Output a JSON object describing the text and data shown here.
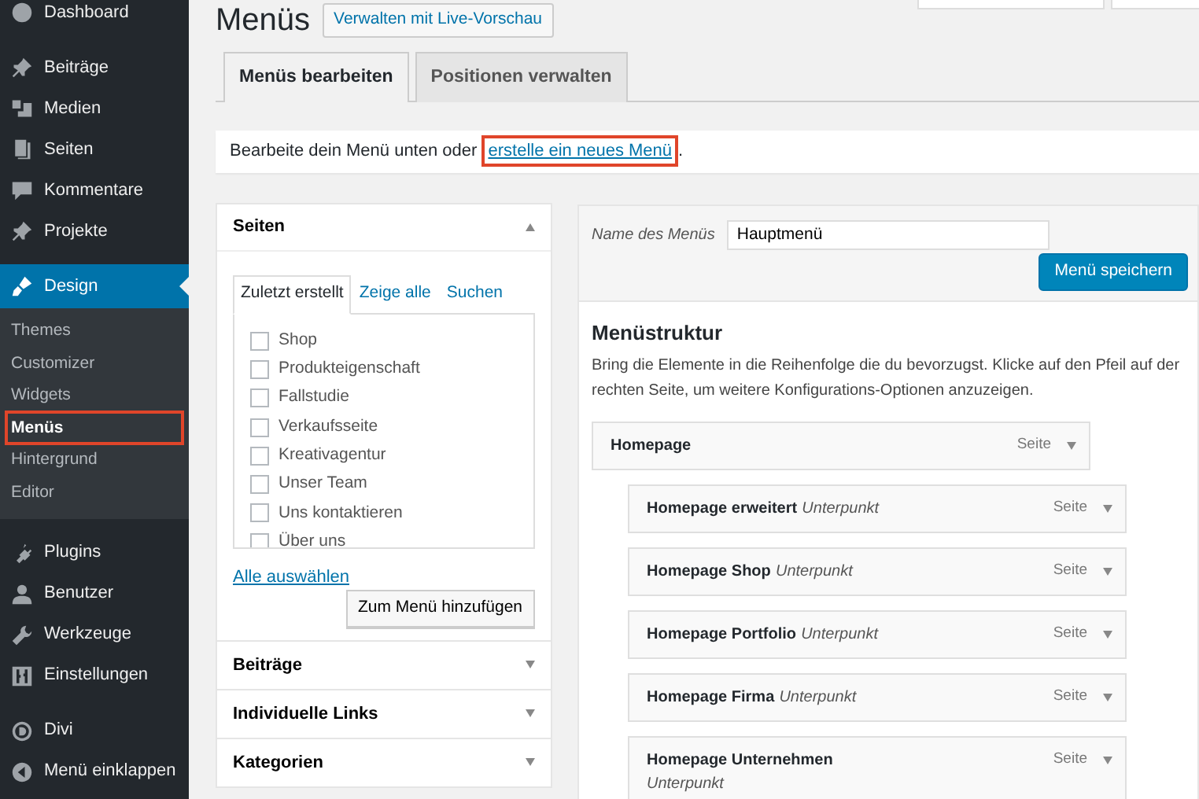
{
  "sidebar": {
    "items": [
      {
        "label": "Dashboard",
        "selected": false
      },
      {
        "label": "Beiträge",
        "selected": false
      },
      {
        "label": "Medien",
        "selected": false
      },
      {
        "label": "Seiten",
        "selected": false
      },
      {
        "label": "Kommentare",
        "selected": false
      },
      {
        "label": "Projekte",
        "selected": false
      },
      {
        "label": "Design",
        "selected": true,
        "children": [
          {
            "label": "Themes",
            "selected": false,
            "highlighted": false
          },
          {
            "label": "Customizer",
            "selected": false,
            "highlighted": false
          },
          {
            "label": "Widgets",
            "selected": false,
            "highlighted": false
          },
          {
            "label": "Menüs",
            "selected": true,
            "highlighted": true
          },
          {
            "label": "Hintergrund",
            "selected": false,
            "highlighted": false
          },
          {
            "label": "Editor",
            "selected": false,
            "highlighted": false
          }
        ]
      },
      {
        "label": "Plugins",
        "selected": false
      },
      {
        "label": "Benutzer",
        "selected": false
      },
      {
        "label": "Werkzeuge",
        "selected": false
      },
      {
        "label": "Einstellungen",
        "selected": false
      },
      {
        "label": "Divi",
        "selected": false
      },
      {
        "label": "Menü einklappen",
        "selected": false
      }
    ]
  },
  "page": {
    "title": "Menüs",
    "live_preview_button": "Verwalten mit Live-Vorschau"
  },
  "tabs": [
    {
      "label": "Menüs bearbeiten",
      "selected": true
    },
    {
      "label": "Positionen verwalten",
      "selected": false
    }
  ],
  "notice": {
    "text": "Bearbeite dein Menü unten oder",
    "link": "erstelle ein neues Menü",
    "link_highlighted": true,
    "end": "."
  },
  "panels": [
    {
      "title": "Seiten",
      "expanded": true,
      "tabs": [
        {
          "label": "Zuletzt erstellt",
          "selected": true
        },
        {
          "label": "Zeige alle",
          "selected": false
        },
        {
          "label": "Suchen",
          "selected": false
        }
      ],
      "items": [
        {
          "label": "Shop",
          "checked": false
        },
        {
          "label": "Produkteigenschaft",
          "checked": false
        },
        {
          "label": "Fallstudie",
          "checked": false
        },
        {
          "label": "Verkaufsseite",
          "checked": false
        },
        {
          "label": "Kreativagentur",
          "checked": false
        },
        {
          "label": "Unser Team",
          "checked": false
        },
        {
          "label": "Uns kontaktieren",
          "checked": false
        },
        {
          "label": "Über uns",
          "checked": false
        }
      ],
      "select_all": "Alle auswählen",
      "add_button": "Zum Menü hinzufügen"
    },
    {
      "title": "Beiträge",
      "expanded": false
    },
    {
      "title": "Individuelle Links",
      "expanded": false
    },
    {
      "title": "Kategorien",
      "expanded": false
    }
  ],
  "menu_editor": {
    "name_label": "Name des Menüs",
    "name_value": "Hauptmenü",
    "save_button": "Menü speichern",
    "heading": "Menüstruktur",
    "description": "Bring die Elemente in die Reihenfolge die du bevorzugst. Klicke auf den Pfeil auf der rechten Seite, um weitere Konfigurations-Optionen anzuzeigen.",
    "items": [
      {
        "title": "Homepage",
        "type": "Seite",
        "children": [
          {
            "title": "Homepage erweitert",
            "subtitle": "Unterpunkt",
            "type": "Seite"
          },
          {
            "title": "Homepage Shop",
            "subtitle": "Unterpunkt",
            "type": "Seite"
          },
          {
            "title": "Homepage Portfolio",
            "subtitle": "Unterpunkt",
            "type": "Seite"
          },
          {
            "title": "Homepage Firma",
            "subtitle": "Unterpunkt",
            "type": "Seite"
          },
          {
            "title": "Homepage Unternehmen",
            "subtitle": "Unterpunkt",
            "type": "Seite"
          }
        ]
      }
    ]
  }
}
